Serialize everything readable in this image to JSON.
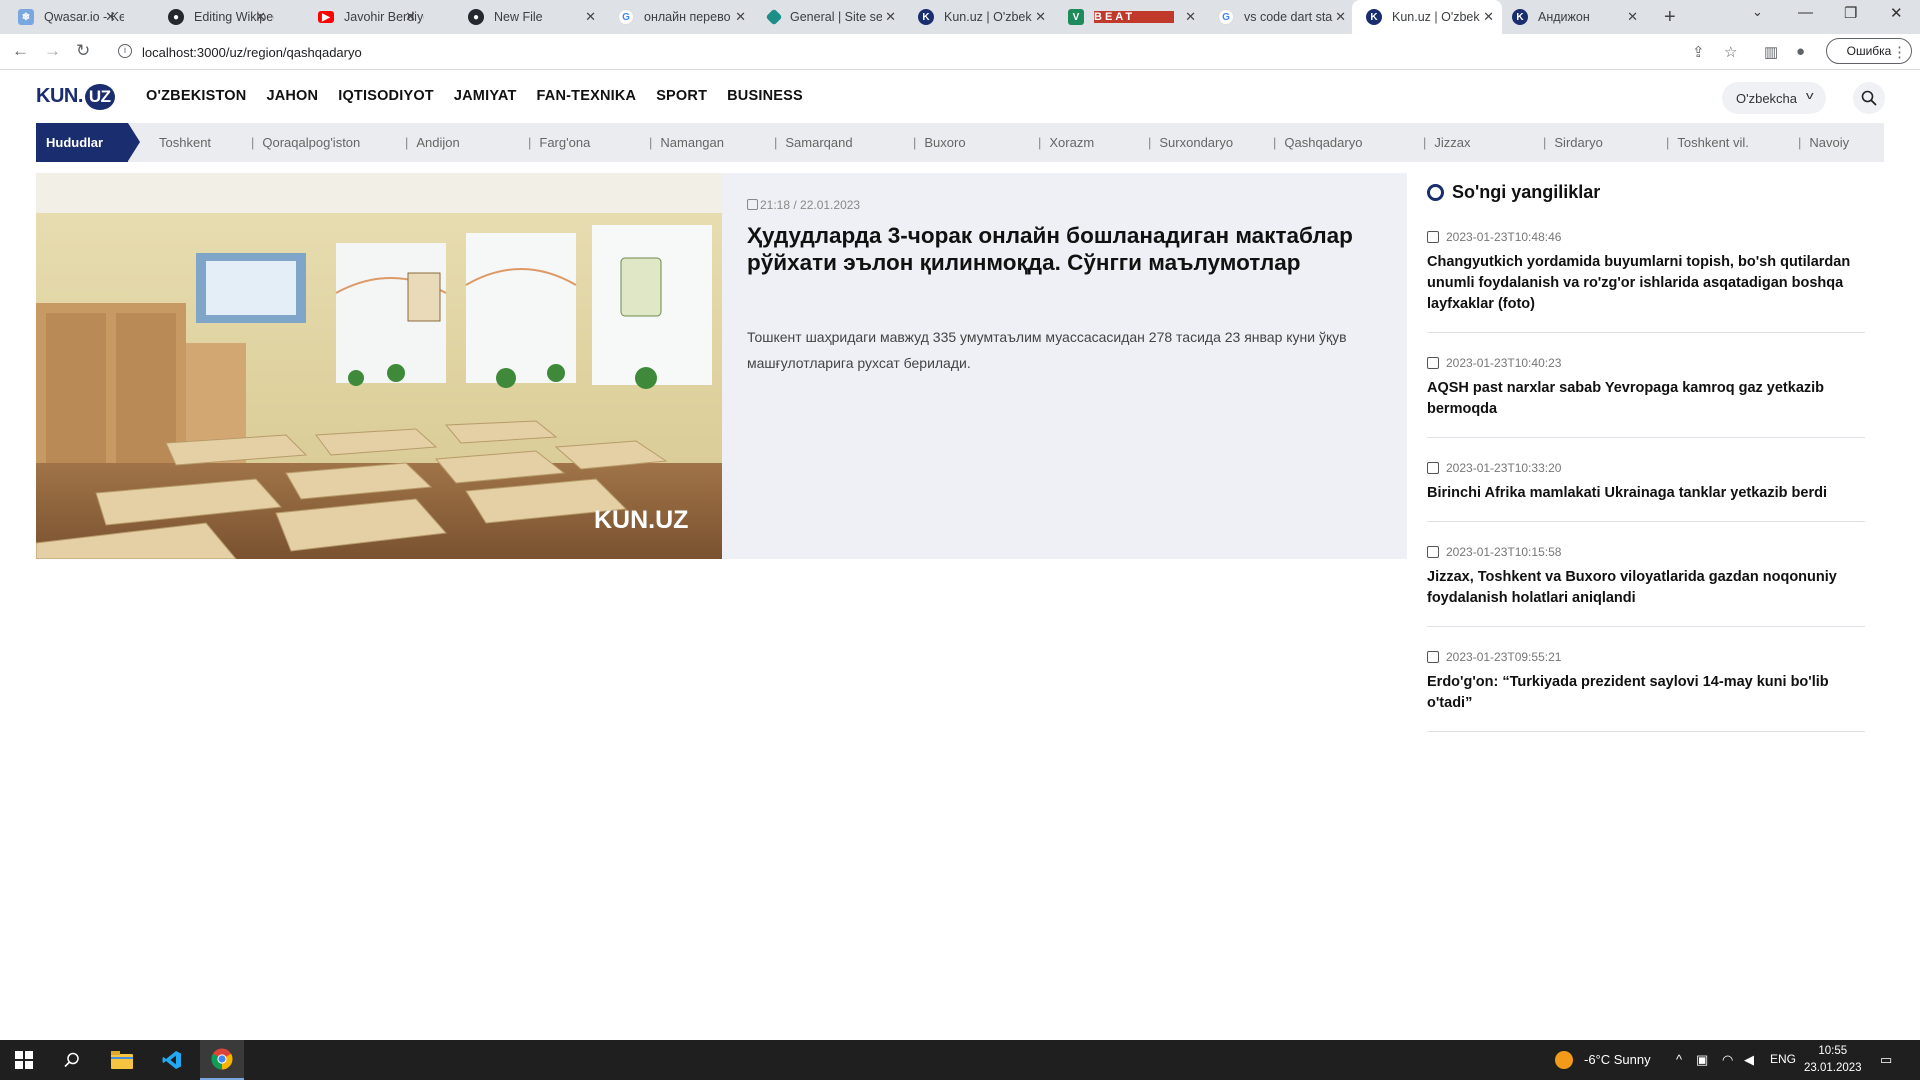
{
  "browser": {
    "tabs": [
      {
        "title": "Qwasar.io - Kee",
        "icon": "qwasar-icon",
        "color": "#7aa7e0"
      },
      {
        "title": "Editing Wikipedi",
        "icon": "github-icon",
        "color": "#24292f"
      },
      {
        "title": "Javohir Berdiyev",
        "icon": "youtube-icon",
        "color": "#ff0000"
      },
      {
        "title": "New File",
        "icon": "github-icon",
        "color": "#24292f"
      },
      {
        "title": "онлайн перево",
        "icon": "google-icon",
        "color": "#4285f4"
      },
      {
        "title": "General | Site se",
        "icon": "site-icon",
        "color": "#1b8f87"
      },
      {
        "title": "Kun.uz | O'zbek",
        "icon": "kun-icon",
        "color": "#1a2d6e"
      },
      {
        "title": "BEAT",
        "icon": "beat-icon",
        "color": "#1e8c5a"
      },
      {
        "title": "vs code dart sta",
        "icon": "google-icon",
        "color": "#4285f4"
      },
      {
        "title": "Kun.uz | O'zbek",
        "icon": "kun-icon",
        "color": "#1a2d6e",
        "active": true
      },
      {
        "title": "Андижон",
        "icon": "kun-icon",
        "color": "#1a2d6e"
      }
    ],
    "url": "localhost:3000/uz/region/qashqadaryo",
    "error_button": "Ошибка"
  },
  "site": {
    "logo_text": "KUN.",
    "logo_badge": "UZ",
    "nav": [
      "O'ZBEKISTON",
      "JAHON",
      "IQTISODIYOT",
      "JAMIYAT",
      "FAN-TEXNIKA",
      "SPORT",
      "BUSINESS"
    ],
    "language": "O'zbekcha",
    "regions_label": "Hududlar",
    "regions": [
      "Toshkent",
      "Qoraqalpog'iston",
      "Andijon",
      "Farg'ona",
      "Namangan",
      "Samarqand",
      "Buxoro",
      "Xorazm",
      "Surxondaryo",
      "Qashqadaryo",
      "Jizzax",
      "Sirdaryo",
      "Toshkent vil.",
      "Navoiy"
    ]
  },
  "featured": {
    "datetime": "21:18 / 22.01.2023",
    "title": "Ҳудудларда 3-чорак онлайн бошланадиган мактаблар рўйхати эълон қилинмоқда. Сўнгги маълумотлар",
    "lead": "Тошкент шаҳридаги мавжуд 335 умумтаълим муассасасидан 278 тасида 23 январ куни ўқув машғулотларига рухсат берилади.",
    "watermark": "KUN.UZ"
  },
  "latest": {
    "heading": "So'ngi yangiliklar",
    "items": [
      {
        "date": "2023-01-23T10:48:46",
        "title": "Changyutkich yordamida buyumlarni topish, bo'sh qutilardan unumli foydalanish va ro'zg'or ishlarida asqatadigan boshqa layfxaklar (foto)"
      },
      {
        "date": "2023-01-23T10:40:23",
        "title": "AQSH past narxlar sabab Yevropaga kamroq gaz yetkazib bermoqda"
      },
      {
        "date": "2023-01-23T10:33:20",
        "title": "Birinchi Afrika mamlakati Ukrainaga tanklar yetkazib berdi"
      },
      {
        "date": "2023-01-23T10:15:58",
        "title": "Jizzax, Toshkent va Buxoro viloyatlarida gazdan noqonuniy foydalanish holatlari aniqlandi"
      },
      {
        "date": "2023-01-23T09:55:21",
        "title": "Erdo'g'on: “Turkiyada prezident saylovi 14-may kuni bo'lib o'tadi”"
      }
    ]
  },
  "taskbar": {
    "weather": "-6°C  Sunny",
    "lang": "ENG",
    "time": "10:55",
    "date": "23.01.2023"
  }
}
